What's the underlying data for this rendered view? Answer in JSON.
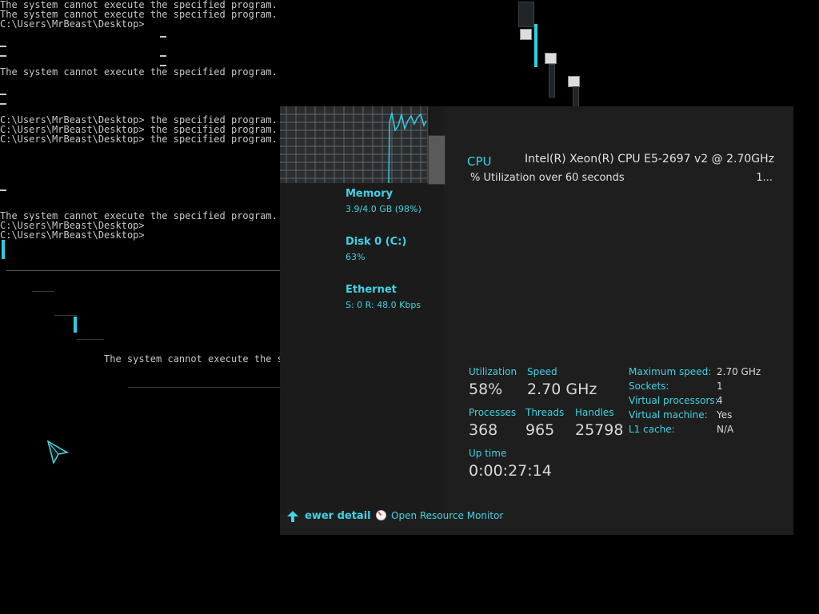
{
  "console": {
    "lines": [
      "The system cannot execute the specified program.",
      "The system cannot execute the specified program.",
      "C:\\Users\\MrBeast\\Desktop>",
      "The system cannot execute the specified program.",
      "C:\\Users\\MrBeast\\Desktop> the specified program.",
      "C:\\Users\\MrBeast\\Desktop> the specified program.",
      "C:\\Users\\MrBeast\\Desktop> the specified program.",
      "The system cannot execute the specified program.",
      "C:\\Users\\MrBeast\\Desktop>",
      "C:\\Users\\MrBeast\\Desktop>"
    ],
    "floating_text": "The system cannot execute the specified program."
  },
  "task_manager": {
    "sidebar": [
      {
        "title": "Memory",
        "sub": "3.9/4.0 GB (98%)"
      },
      {
        "title": "Disk 0 (C:)",
        "sub": "63%"
      },
      {
        "title": "Ethernet",
        "sub": "S: 0 R: 48.0 Kbps"
      }
    ],
    "cpu": {
      "title": "CPU",
      "name": "Intel(R) Xeon(R) CPU E5-2697 v2 @ 2.70GHz",
      "graph_caption": "% Utilization over 60 seconds",
      "graph_max": "1..."
    },
    "stats": {
      "utilization_label": "Utilization",
      "utilization_value": "58%",
      "speed_label": "Speed",
      "speed_value": "2.70 GHz",
      "processes_label": "Processes",
      "processes_value": "368",
      "threads_label": "Threads",
      "threads_value": "965",
      "handles_label": "Handles",
      "handles_value": "25798",
      "uptime_label": "Up time",
      "uptime_value": "0:00:27:14"
    },
    "details": [
      {
        "label": "Maximum speed:",
        "value": "2.70 GHz"
      },
      {
        "label": "Sockets:",
        "value": "1"
      },
      {
        "label": "Virtual processors:",
        "value": "4"
      },
      {
        "label": "Virtual machine:",
        "value": "Yes"
      },
      {
        "label": "L1 cache:",
        "value": "N/A"
      }
    ],
    "footer": {
      "fewer_details": "ewer detail",
      "open_resource_monitor": "Open Resource Monitor"
    }
  },
  "colors": {
    "accent": "#3fd3e4",
    "panel": "#1e1e1e",
    "console_text": "#c8c8c8"
  }
}
